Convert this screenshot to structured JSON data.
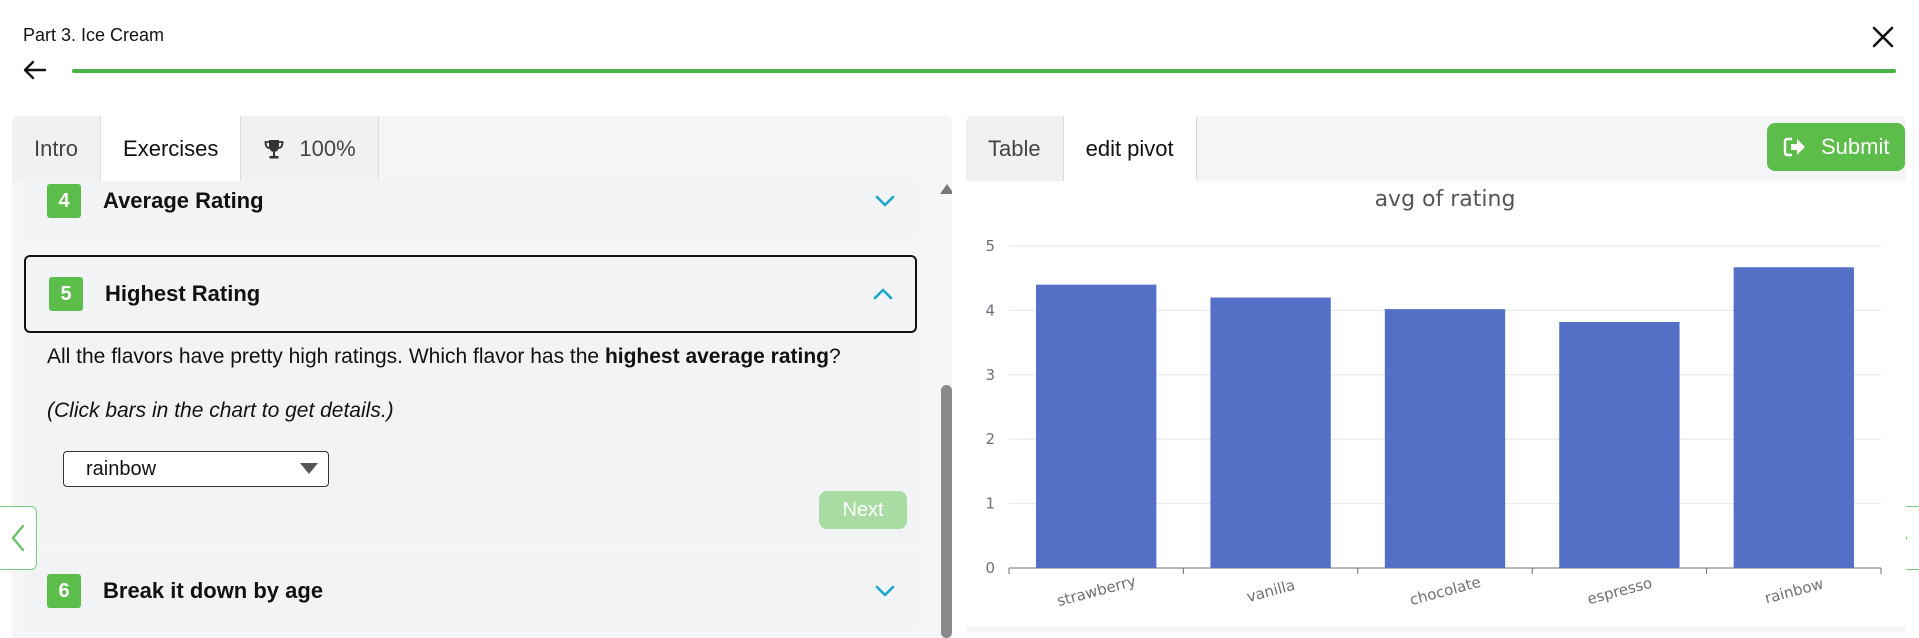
{
  "header": {
    "title": "Part 3. Ice Cream",
    "progress": 1.0
  },
  "left_tabs": [
    {
      "label": "Intro"
    },
    {
      "label": "Exercises"
    },
    {
      "label": "100%",
      "icon": "trophy-icon"
    }
  ],
  "exercises": {
    "ex4": {
      "number": "4",
      "title": "Average Rating"
    },
    "ex5": {
      "number": "5",
      "title": "Highest Rating",
      "question_before": "All the flavors have pretty high ratings. Which flavor has the ",
      "question_bold": "highest average rating",
      "question_after": "?",
      "hint": "(Click bars in the chart to get details.)",
      "answer_value": "rainbow",
      "next_label": "Next"
    },
    "ex6": {
      "number": "6",
      "title": "Break it down by age"
    }
  },
  "right_tabs": [
    {
      "label": "Table"
    },
    {
      "label": "edit pivot"
    }
  ],
  "submit_label": "Submit",
  "colors": {
    "accent_green": "#5cbd4a",
    "bar_blue": "#5470c6",
    "chevron_cyan": "#1aa7c9"
  },
  "chart_data": {
    "type": "bar",
    "title": "avg of rating",
    "categories": [
      "strawberry",
      "vanilla",
      "chocolate",
      "espresso",
      "rainbow"
    ],
    "values": [
      4.4,
      4.2,
      4.02,
      3.82,
      4.67
    ],
    "ylim": [
      0,
      5
    ],
    "yticks": [
      "0",
      "1",
      "2",
      "3",
      "4",
      "5"
    ],
    "grid": true
  }
}
